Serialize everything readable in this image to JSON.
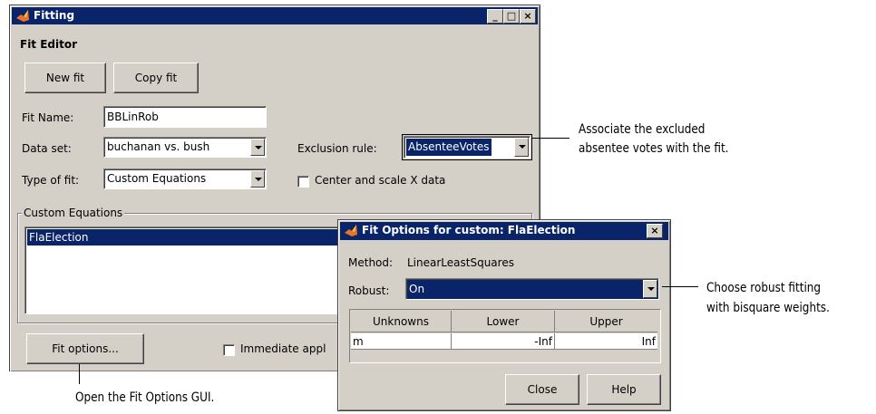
{
  "main_window": {
    "title": "Fitting",
    "section_title": "Fit Editor",
    "new_fit_button": "New fit",
    "copy_fit_button": "Copy fit",
    "fit_name_label": "Fit Name:",
    "fit_name_value": "BBLinRob",
    "data_set_label": "Data set:",
    "data_set_value": "buchanan vs. bush",
    "exclusion_rule_label": "Exclusion rule:",
    "exclusion_rule_value": "AbsenteeVotes",
    "type_of_fit_label": "Type of fit:",
    "type_of_fit_value": "Custom Equations",
    "center_scale_label": "Center and scale X data",
    "custom_equations_group": "Custom Equations",
    "equations": [
      "FlaElection"
    ],
    "fit_options_button": "Fit options...",
    "immediate_apply_label": "Immediate appl"
  },
  "options_dialog": {
    "title": "Fit Options for custom: FlaElection",
    "method_label": "Method:",
    "method_value": "LinearLeastSquares",
    "robust_label": "Robust:",
    "robust_value": "On",
    "table_headers": [
      "Unknowns",
      "Lower",
      "Upper"
    ],
    "table_rows": [
      {
        "unknown": "m",
        "lower": "-Inf",
        "upper": "Inf"
      }
    ],
    "close_button": "Close",
    "help_button": "Help"
  },
  "annotations": {
    "exclusion_line1": "Associate the excluded",
    "exclusion_line2": "absentee votes with the fit.",
    "robust_line1": "Choose robust fitting",
    "robust_line2": "with bisquare weights.",
    "fit_options_note": "Open the Fit Options GUI."
  },
  "colors": {
    "title_bar": "#0a246a",
    "dialog_face": "#d4d0c8",
    "selection": "#0a246a"
  }
}
